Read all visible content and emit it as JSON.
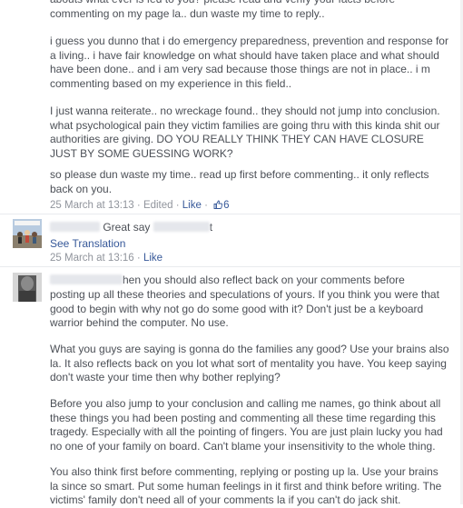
{
  "comment1": {
    "paragraphs": [
      "abouts what ever is fed to you? please read and verify your facts before commenting on my page la.. dun waste my time to reply..",
      "i guess you dunno that i do emergency preparedness, prevention and response for a living.. i have fair knowledge on what should have taken place and what should have been done.. and i am very sad because those things are not in place.. i m commenting based on my experience in this field..",
      "I just wanna reiterate.. no wreckage found.. they should not jump into conclusion. what psychological pain they victim families are going thru with this kinda shit our authorities are giving. DO YOU REALLY THINK THEY CAN HAVE CLOSURE JUST BY SOME GUESSING WORK?",
      "so please dun waste my time.. read up first before commenting.. it only reflects back on you."
    ],
    "timestamp": "25 March at 13:13",
    "edited": "Edited",
    "like_label": "Like",
    "like_count": "6"
  },
  "comment2": {
    "text_a": "Great say",
    "text_b": "t",
    "see_translation": "See Translation",
    "timestamp": "25 March at 13:16",
    "like_label": "Like"
  },
  "comment3": {
    "first_line_tail": "hen you should also reflect back on your comments before",
    "first_para_rest": "posting up all these theories and speculations of yours. If you think you were that good to begin with why not go do some good with it? Don't just be a keyboard warrior behind the computer. No use.",
    "paragraphs": [
      "What you guys are saying is gonna do the families any good? Use your brains also la. It also reflects back on you lot what sort of mentality you have. You keep saying don't waste your time then why bother replying?",
      "Before you also jump to your conclusion and calling me names, go think about all these things you had been posting and commenting all these time regarding this tragedy. Especially with all the pointing of fingers. You are just plain lucky you had no one of your family on board. Can't blame your insensitivity to the whole thing.",
      "You also think first before commenting, replying or posting up la. Use your brains la since so smart. Put some human feelings in it first and think before writing. The victims' family don't need all of your comments la if you can't do jack shit."
    ]
  },
  "colors": {
    "link": "#365899",
    "meta": "#90949c",
    "text": "#4b4f56"
  },
  "icons": [
    "thumbs-up-icon",
    "avatar-cartoon",
    "avatar-person"
  ]
}
